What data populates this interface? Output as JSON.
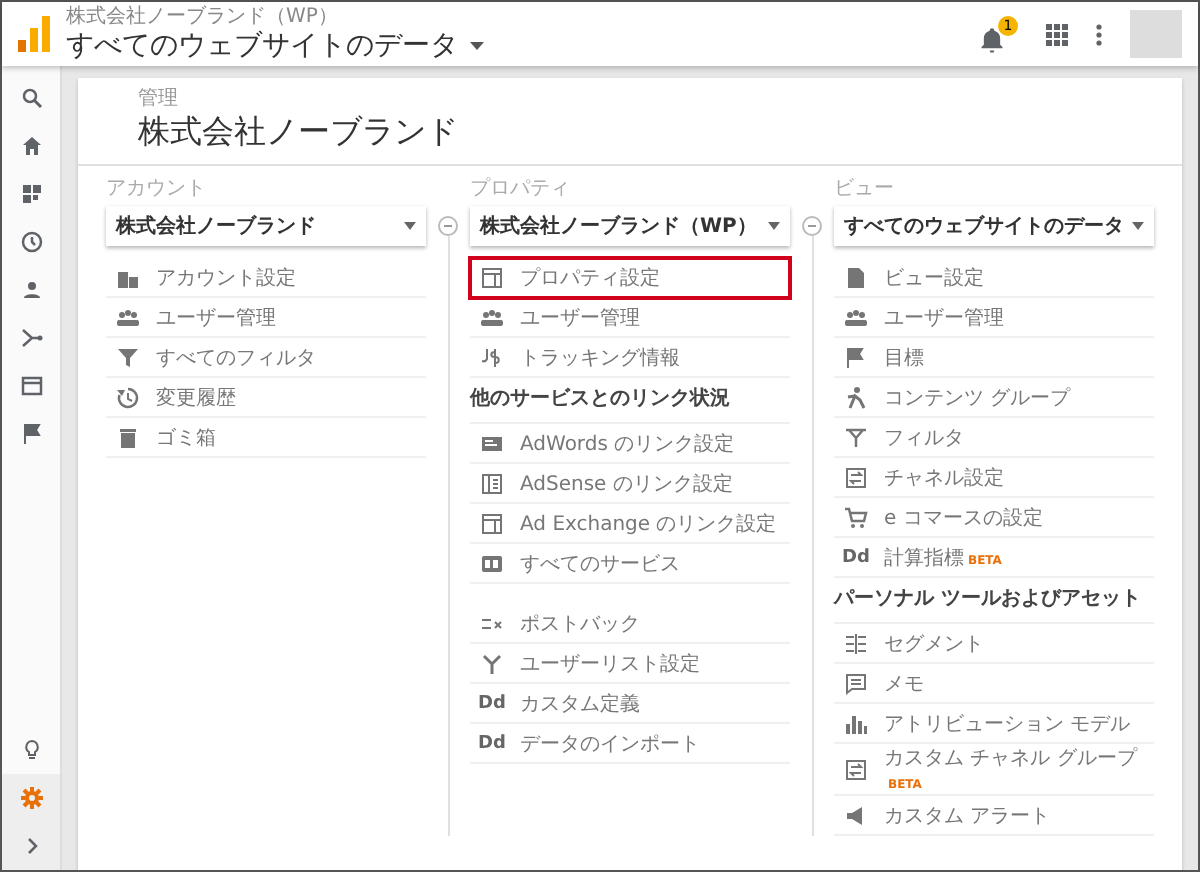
{
  "topbar": {
    "account": "株式会社ノーブランド（WP）",
    "view": "すべてのウェブサイトのデータ",
    "notifications": "1"
  },
  "sidebar": {
    "items": [
      {
        "selected": false
      },
      {
        "selected": false
      },
      {
        "selected": false
      },
      {
        "selected": false
      },
      {
        "selected": false
      },
      {
        "selected": false
      },
      {
        "selected": false
      },
      {
        "selected": false
      },
      {
        "selected": false
      },
      {
        "selected": true
      },
      {
        "selected": false
      }
    ]
  },
  "admin": {
    "breadcrumb": "管理",
    "title": "株式会社ノーブランド",
    "columns": [
      {
        "label": "アカウント",
        "dropdown": "株式会社ノーブランド",
        "sections": [
          {
            "items": [
              {
                "label": "アカウント設定",
                "highlighted": false
              },
              {
                "label": "ユーザー管理",
                "highlighted": false
              },
              {
                "label": "すべてのフィルタ",
                "highlighted": false
              },
              {
                "label": "変更履歴",
                "highlighted": false
              },
              {
                "label": "ゴミ箱",
                "highlighted": false
              }
            ]
          }
        ]
      },
      {
        "label": "プロパティ",
        "dropdown": "株式会社ノーブランド（WP）",
        "sections": [
          {
            "items": [
              {
                "label": "プロパティ設定",
                "highlighted": true
              },
              {
                "label": "ユーザー管理",
                "highlighted": false
              },
              {
                "label": "トラッキング情報",
                "highlighted": false
              }
            ]
          },
          {
            "title": "他のサービスとのリンク状況",
            "items": [
              {
                "label": "AdWords のリンク設定",
                "highlighted": false
              },
              {
                "label": "AdSense のリンク設定",
                "highlighted": false
              },
              {
                "label": "Ad Exchange のリンク設定",
                "highlighted": false
              },
              {
                "label": "すべてのサービス",
                "highlighted": false
              }
            ]
          },
          {
            "items": [
              {
                "label": "ポストバック",
                "highlighted": false
              },
              {
                "label": "ユーザーリスト設定",
                "highlighted": false
              },
              {
                "label": "カスタム定義",
                "highlighted": false,
                "icon_text": "Dd"
              },
              {
                "label": "データのインポート",
                "highlighted": false,
                "icon_text": "Dd"
              }
            ]
          }
        ]
      },
      {
        "label": "ビュー",
        "dropdown": "すべてのウェブサイトのデータ",
        "sections": [
          {
            "items": [
              {
                "label": "ビュー設定",
                "highlighted": false
              },
              {
                "label": "ユーザー管理",
                "highlighted": false
              },
              {
                "label": "目標",
                "highlighted": false
              },
              {
                "label": "コンテンツ グループ",
                "highlighted": false
              },
              {
                "label": "フィルタ",
                "highlighted": false
              },
              {
                "label": "チャネル設定",
                "highlighted": false
              },
              {
                "label": "e コマースの設定",
                "highlighted": false
              },
              {
                "label": "計算指標",
                "highlighted": false,
                "icon_text": "Dd",
                "badge": "BETA"
              }
            ]
          },
          {
            "title": "パーソナル ツールおよびアセット",
            "items": [
              {
                "label": "セグメント",
                "highlighted": false
              },
              {
                "label": "メモ",
                "highlighted": false
              },
              {
                "label": "アトリビューション モデル",
                "highlighted": false
              },
              {
                "label": "カスタム チャネル グループ",
                "highlighted": false,
                "badge": "BETA"
              },
              {
                "label": "カスタム アラート",
                "highlighted": false
              }
            ]
          }
        ]
      }
    ]
  }
}
